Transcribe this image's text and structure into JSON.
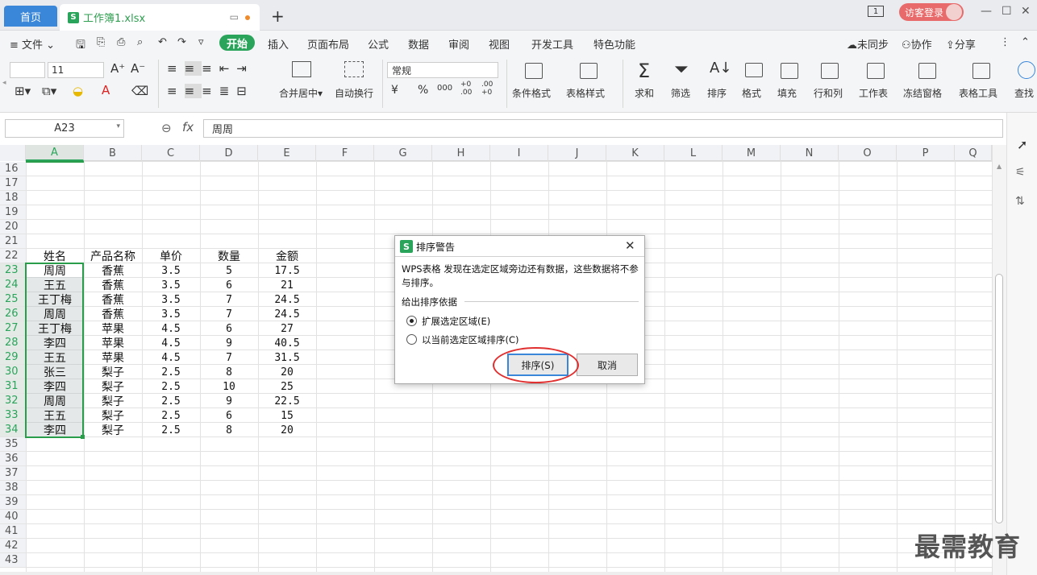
{
  "titlebar": {
    "home_tab": "首页",
    "file_tab": "工作簿1.xlsx",
    "new_tab": "+",
    "page_badge": "1",
    "visitor_login": "访客登录",
    "minimize": "—",
    "restore": "☐",
    "close": "✕"
  },
  "menubar": {
    "file": "文件",
    "tabs": [
      "开始",
      "插入",
      "页面布局",
      "公式",
      "数据",
      "审阅",
      "视图",
      "开发工具",
      "特色功能"
    ],
    "search": "查找",
    "sync": "未同步",
    "collab": "协作",
    "share": "分享"
  },
  "ribbon": {
    "font_size": "11",
    "number_format": "常规",
    "merge_center": "合并居中",
    "wrap_text": "自动换行",
    "currency": "¥",
    "percent": "%",
    "thousands": "000",
    "dec_inc": "+0 .00",
    "dec_dec": ".00 +0",
    "cond_format": "条件格式",
    "table_style": "表格样式",
    "sum": "求和",
    "filter": "筛选",
    "sort": "排序",
    "format": "格式",
    "fill": "填充",
    "row_col": "行和列",
    "worksheet": "工作表",
    "freeze": "冻结窗格",
    "table_tools": "表格工具",
    "find": "查找"
  },
  "formula_bar": {
    "name_box": "A23",
    "fx": "fx",
    "content": "周周"
  },
  "columns": [
    "A",
    "B",
    "C",
    "D",
    "E",
    "F",
    "G",
    "H",
    "I",
    "J",
    "K",
    "L",
    "M",
    "N",
    "O",
    "P",
    "Q"
  ],
  "row_numbers": [
    "16",
    "17",
    "18",
    "19",
    "20",
    "21",
    "22",
    "23",
    "24",
    "25",
    "26",
    "27",
    "28",
    "29",
    "30",
    "31",
    "32",
    "33",
    "34",
    "35",
    "36",
    "37",
    "38",
    "39",
    "40",
    "41",
    "42",
    "43"
  ],
  "table": {
    "headers": [
      "姓名",
      "产品名称",
      "单价",
      "数量",
      "金额"
    ],
    "rows": [
      [
        "周周",
        "香蕉",
        "3.5",
        "5",
        "17.5"
      ],
      [
        "王五",
        "香蕉",
        "3.5",
        "6",
        "21"
      ],
      [
        "王丁梅",
        "香蕉",
        "3.5",
        "7",
        "24.5"
      ],
      [
        "周周",
        "香蕉",
        "3.5",
        "7",
        "24.5"
      ],
      [
        "王丁梅",
        "苹果",
        "4.5",
        "6",
        "27"
      ],
      [
        "李四",
        "苹果",
        "4.5",
        "9",
        "40.5"
      ],
      [
        "王五",
        "苹果",
        "4.5",
        "7",
        "31.5"
      ],
      [
        "张三",
        "梨子",
        "2.5",
        "8",
        "20"
      ],
      [
        "李四",
        "梨子",
        "2.5",
        "10",
        "25"
      ],
      [
        "周周",
        "梨子",
        "2.5",
        "9",
        "22.5"
      ],
      [
        "王五",
        "梨子",
        "2.5",
        "6",
        "15"
      ],
      [
        "李四",
        "梨子",
        "2.5",
        "8",
        "20"
      ]
    ]
  },
  "dialog": {
    "title": "排序警告",
    "message": "WPS表格 发现在选定区域旁边还有数据，这些数据将不参与排序。",
    "group_label": "给出排序依据",
    "option_expand": "扩展选定区域(E)",
    "option_current": "以当前选定区域排序(C)",
    "sort_button": "排序(S)",
    "cancel_button": "取消",
    "selected_option": "option_expand"
  },
  "watermark": "最需教育",
  "colors": {
    "accent_green": "#2aa45a",
    "selection_green": "#2a9d4a",
    "highlight_red": "#e03030",
    "tab_blue": "#3a86d9"
  }
}
